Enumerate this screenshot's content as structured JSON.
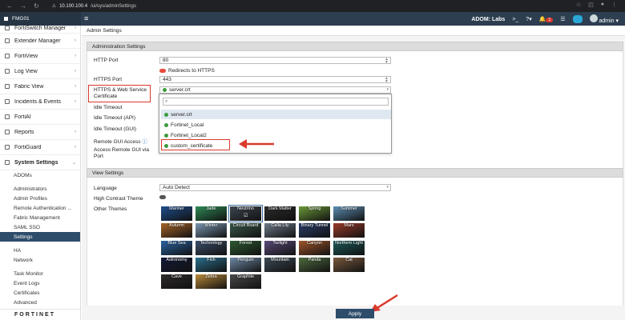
{
  "browser": {
    "url_prefix": "10.100.100.4",
    "url_path": "/ui/sys/adminSettings"
  },
  "app": {
    "device": "FMG01",
    "adom": "ADOM: Labs",
    "notif_count": "1",
    "user": "admin",
    "brand_color": "#2c3e50",
    "accent_color": "#d93a2b"
  },
  "sidebar": {
    "items": [
      {
        "label": "FortiSwitch Manager",
        "icon": "switch-icon"
      },
      {
        "label": "Extender Manager",
        "icon": "extender-icon"
      },
      {
        "label": "FortiView",
        "icon": "chart-icon"
      },
      {
        "label": "Log View",
        "icon": "log-icon"
      },
      {
        "label": "Fabric View",
        "icon": "fabric-icon"
      },
      {
        "label": "Incidents & Events",
        "icon": "bell-icon"
      },
      {
        "label": "FortiAI",
        "icon": "ai-icon"
      },
      {
        "label": "Reports",
        "icon": "report-icon"
      },
      {
        "label": "FortiGuard",
        "icon": "shield-icon"
      },
      {
        "label": "System Settings",
        "icon": "gear-icon"
      }
    ],
    "sub": {
      "adoms": "ADOMs",
      "administrators": "Administrators",
      "admin_profiles": "Admin Profiles",
      "remote_auth": "Remote Authentication ...",
      "fabric_management": "Fabric Management",
      "saml_sso": "SAML SSO",
      "settings": "Settings",
      "ha": "HA",
      "network": "Network",
      "task_monitor": "Task Monitor",
      "event_logs": "Event Logs",
      "certificates": "Certificates",
      "advanced": "Advanced"
    },
    "logo": "FORTINET"
  },
  "main": {
    "breadcrumb": "Admin Settings",
    "admin_section": "Administration Settings",
    "http_port_label": "HTTP Port",
    "http_port_value": "80",
    "redirect_label": "Redirects to HTTPS",
    "https_port_label": "HTTPS Port",
    "https_port_value": "443",
    "cert_label": "HTTPS & Web Service Certificate",
    "cert_value": "server.crt",
    "idle_timeout_label": "Idle Timeout",
    "idle_api_label": "Idle Timeout (API)",
    "idle_gui_label": "Idle Timeout (GUI)",
    "remote_gui_label": "Remote GUI Access",
    "remote_gui_port_label": "Access Remote GUI via Port",
    "dropdown_options": [
      "server.crt",
      "Fortinet_Local",
      "Fortinet_Local2",
      "custom_certificate"
    ],
    "view_section": "View Settings",
    "language_label": "Language",
    "language_value": "Auto Detect",
    "contrast_label": "High Contrast Theme",
    "themes_label": "Other Themes",
    "themes": [
      "Mariner",
      "Jade",
      "Neutrino",
      "Dark Matter",
      "Spring",
      "Summer",
      "Autumn",
      "Winter",
      "Circuit Board",
      "Calla Lily",
      "Binary Tunnel",
      "Mars",
      "Blue Sea",
      "Technology",
      "Forest",
      "Twilight",
      "Canyon",
      "Northern Light",
      "Astronomy",
      "Fish",
      "Penguin",
      "Mountain",
      "Panda",
      "Cat",
      "Cave",
      "Zebra",
      "Graphite"
    ],
    "theme_colors": [
      "#1f4e8c",
      "#2e8b57",
      "#3d4752",
      "#2b2b2b",
      "#6b9a3a",
      "#5d8fb3",
      "#a7652a",
      "#7c97b2",
      "#3a5a4a",
      "#6f7b8a",
      "#2b3f6b",
      "#9a3b2a",
      "#2a64a3",
      "#3b4f6a",
      "#2f5b32",
      "#5c4a7a",
      "#a0562c",
      "#1d5a5a",
      "#141a38",
      "#2a6f8c",
      "#6f8aa6",
      "#3c4a55",
      "#4f6b3f",
      "#7a5a3f",
      "#2e2a2a",
      "#b98a3a",
      "#4a4a4a"
    ],
    "apply_label": "Apply"
  }
}
